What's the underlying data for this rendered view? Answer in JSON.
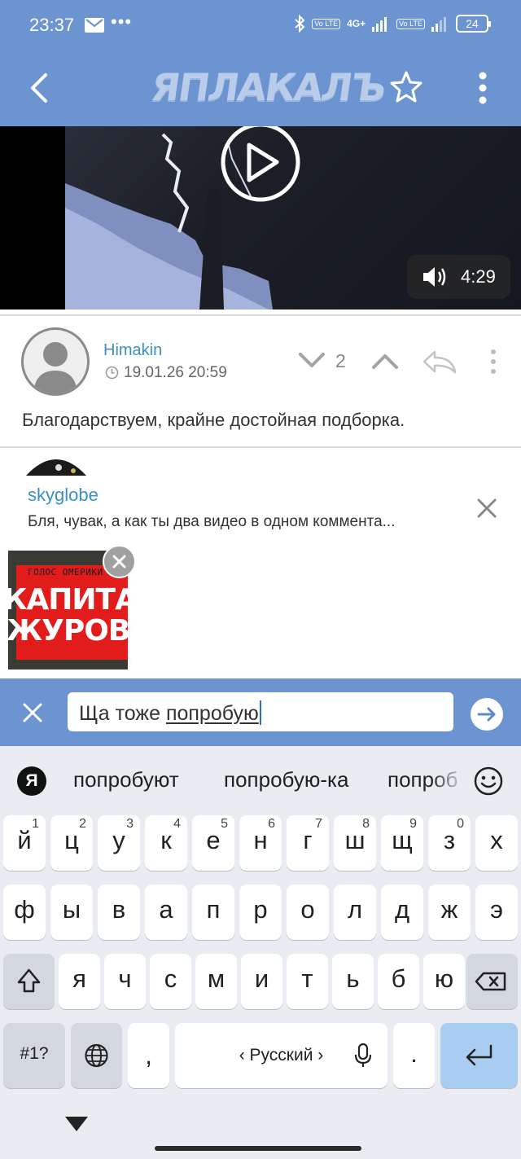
{
  "status_bar": {
    "time": "23:37",
    "dots": "•••",
    "volte1": "Vo LTE",
    "network": "4G+",
    "volte2": "Vo LTE",
    "battery": "24"
  },
  "app_bar": {
    "logo": "ЯПЛАКАЛЪ"
  },
  "video": {
    "duration": "4:29"
  },
  "comment": {
    "author": "Himakin",
    "date": "19.01.26 20:59",
    "rating": "2",
    "text": "Благодарствуем, крайне достойная подборка."
  },
  "reply_to": {
    "user": "skyglobe",
    "quote": "Бля, чувак, а как ты два видео в одном коммента..."
  },
  "attachment": {
    "top_text": "ГОЛОС ОМЕРИКИ",
    "line1": "КАПИТАН",
    "line2": "ЖУРОВ"
  },
  "input": {
    "text_before": "Ща тоже ",
    "text_word": "попробую"
  },
  "keyboard": {
    "ya_label": "Я",
    "suggestions": [
      "попробуют",
      "попробую-ка",
      "попроб"
    ],
    "row1": [
      {
        "key": "й",
        "hint": "1"
      },
      {
        "key": "ц",
        "hint": "2"
      },
      {
        "key": "у",
        "hint": "3"
      },
      {
        "key": "к",
        "hint": "4"
      },
      {
        "key": "е",
        "hint": "5"
      },
      {
        "key": "н",
        "hint": "6"
      },
      {
        "key": "г",
        "hint": "7"
      },
      {
        "key": "ш",
        "hint": "8"
      },
      {
        "key": "щ",
        "hint": "9"
      },
      {
        "key": "з",
        "hint": "0"
      },
      {
        "key": "х",
        "hint": ""
      }
    ],
    "row2": [
      "ф",
      "ы",
      "в",
      "а",
      "п",
      "р",
      "о",
      "л",
      "д",
      "ж",
      "э"
    ],
    "row3": [
      "я",
      "ч",
      "с",
      "м",
      "и",
      "т",
      "ь",
      "б",
      "ю"
    ],
    "symbols_label": "#1?",
    "comma_label": ",",
    "space_label": "‹ Русский ›",
    "period_label": "."
  }
}
